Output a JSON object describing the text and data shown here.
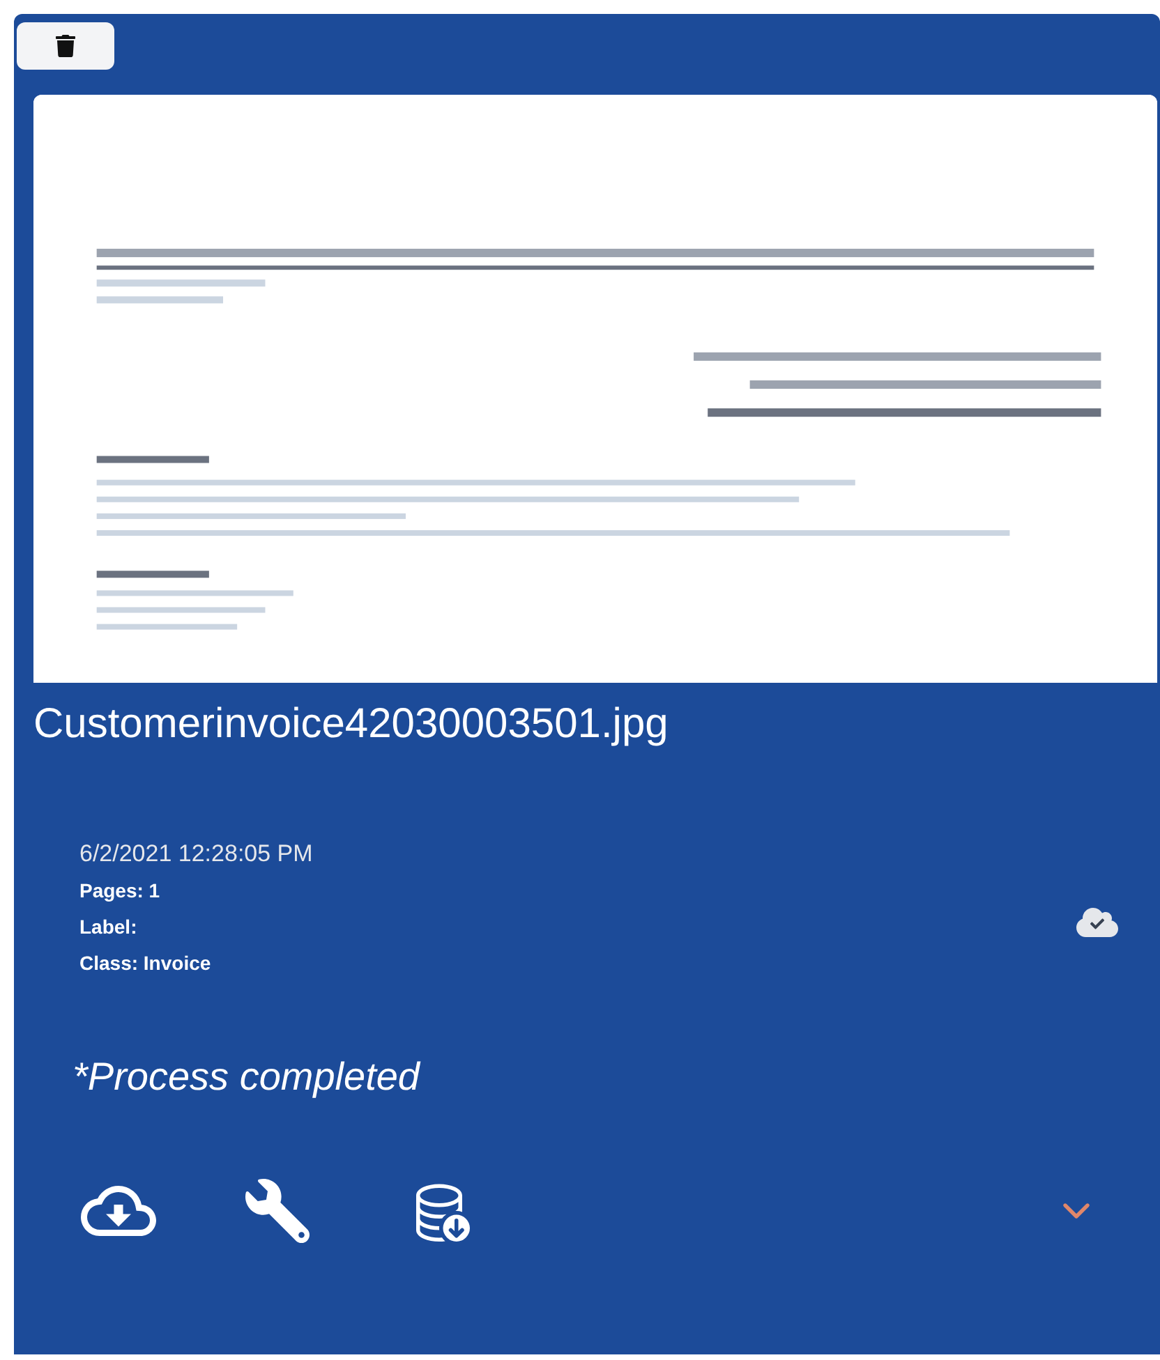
{
  "file_name": "Customerinvoice42030003501.jpg",
  "timestamp": "6/2/2021 12:28:05 PM",
  "details": [
    "Pages: 1",
    "Label:",
    "Class: Invoice"
  ],
  "status": "*Process completed"
}
